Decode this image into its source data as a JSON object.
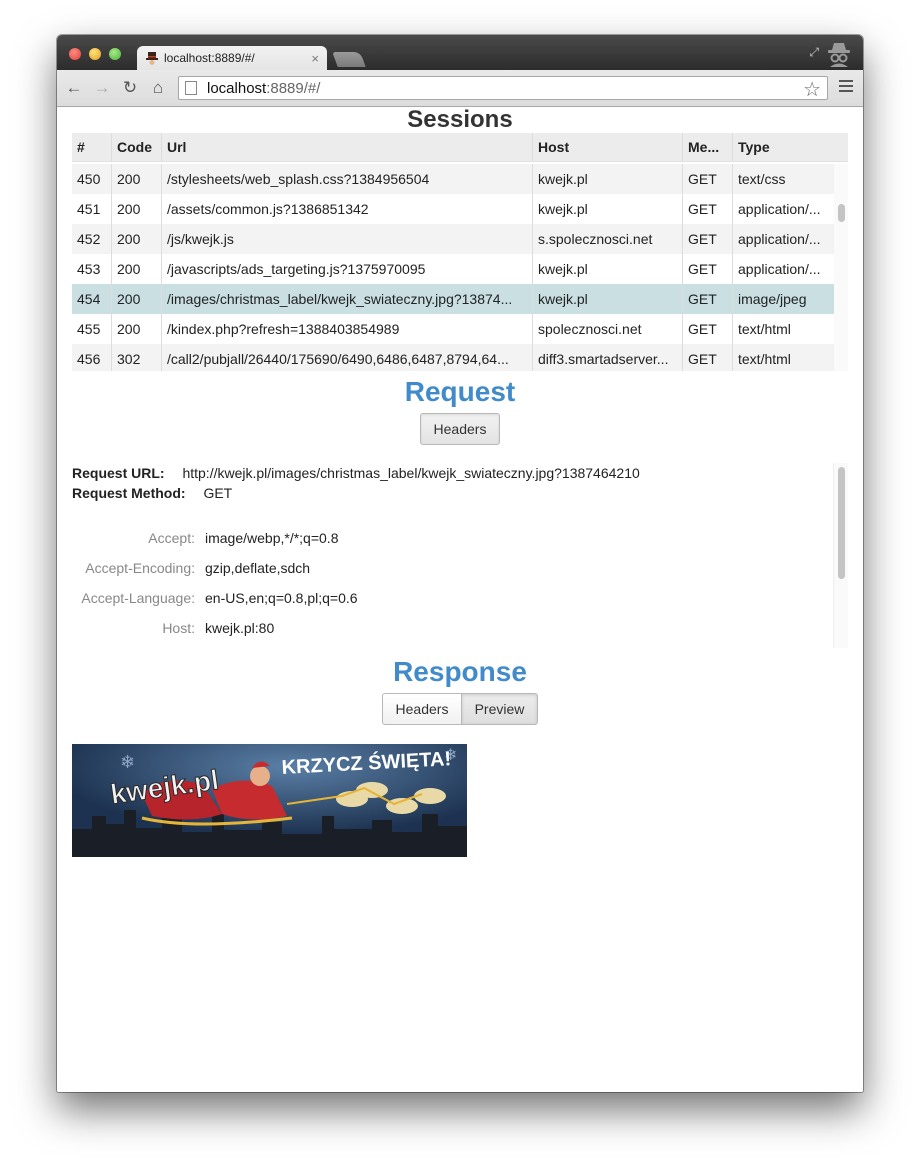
{
  "browser": {
    "tab_title": "localhost:8889/#/",
    "tab_close": "×",
    "url_host": "localhost",
    "url_rest": ":8889/#/"
  },
  "sessions": {
    "title": "Sessions",
    "columns": [
      "#",
      "Code",
      "Url",
      "Host",
      "Me...",
      "Type"
    ],
    "rows": [
      {
        "id": "450",
        "code": "200",
        "url": "/stylesheets/web_splash.css?1384956504",
        "host": "kwejk.pl",
        "method": "GET",
        "type": "text/css"
      },
      {
        "id": "451",
        "code": "200",
        "url": "/assets/common.js?1386851342",
        "host": "kwejk.pl",
        "method": "GET",
        "type": "application/..."
      },
      {
        "id": "452",
        "code": "200",
        "url": "/js/kwejk.js",
        "host": "s.spolecznosci.net",
        "method": "GET",
        "type": "application/..."
      },
      {
        "id": "453",
        "code": "200",
        "url": "/javascripts/ads_targeting.js?1375970095",
        "host": "kwejk.pl",
        "method": "GET",
        "type": "application/..."
      },
      {
        "id": "454",
        "code": "200",
        "url": "/images/christmas_label/kwejk_swiateczny.jpg?13874...",
        "host": "kwejk.pl",
        "method": "GET",
        "type": "image/jpeg"
      },
      {
        "id": "455",
        "code": "200",
        "url": "/kindex.php?refresh=1388403854989",
        "host": "spolecznosci.net",
        "method": "GET",
        "type": "text/html"
      },
      {
        "id": "456",
        "code": "302",
        "url": "/call2/pubjall/26440/175690/6490,6486,6487,8794,64...",
        "host": "diff3.smartadserver...",
        "method": "GET",
        "type": "text/html"
      }
    ],
    "selected_row": "454"
  },
  "request": {
    "title": "Request",
    "headers_button": "Headers",
    "url_label": "Request URL:",
    "url_value": "http://kwejk.pl/images/christmas_label/kwejk_swiateczny.jpg?1387464210",
    "method_label": "Request Method:",
    "method_value": "GET",
    "headers": [
      {
        "name": "Accept:",
        "value": "image/webp,*/*;q=0.8"
      },
      {
        "name": "Accept-Encoding:",
        "value": "gzip,deflate,sdch"
      },
      {
        "name": "Accept-Language:",
        "value": "en-US,en;q=0.8,pl;q=0.6"
      },
      {
        "name": "Host:",
        "value": "kwejk.pl:80"
      }
    ]
  },
  "response": {
    "title": "Response",
    "headers_button": "Headers",
    "preview_button": "Preview",
    "active_tab": "Preview",
    "preview_image": {
      "logo_text": "kwejk.pl",
      "banner_text": "KRZYCZ ŚWIĘTA!"
    }
  },
  "colors": {
    "accent": "#428bca",
    "selected_row": "#c9dfe2"
  }
}
